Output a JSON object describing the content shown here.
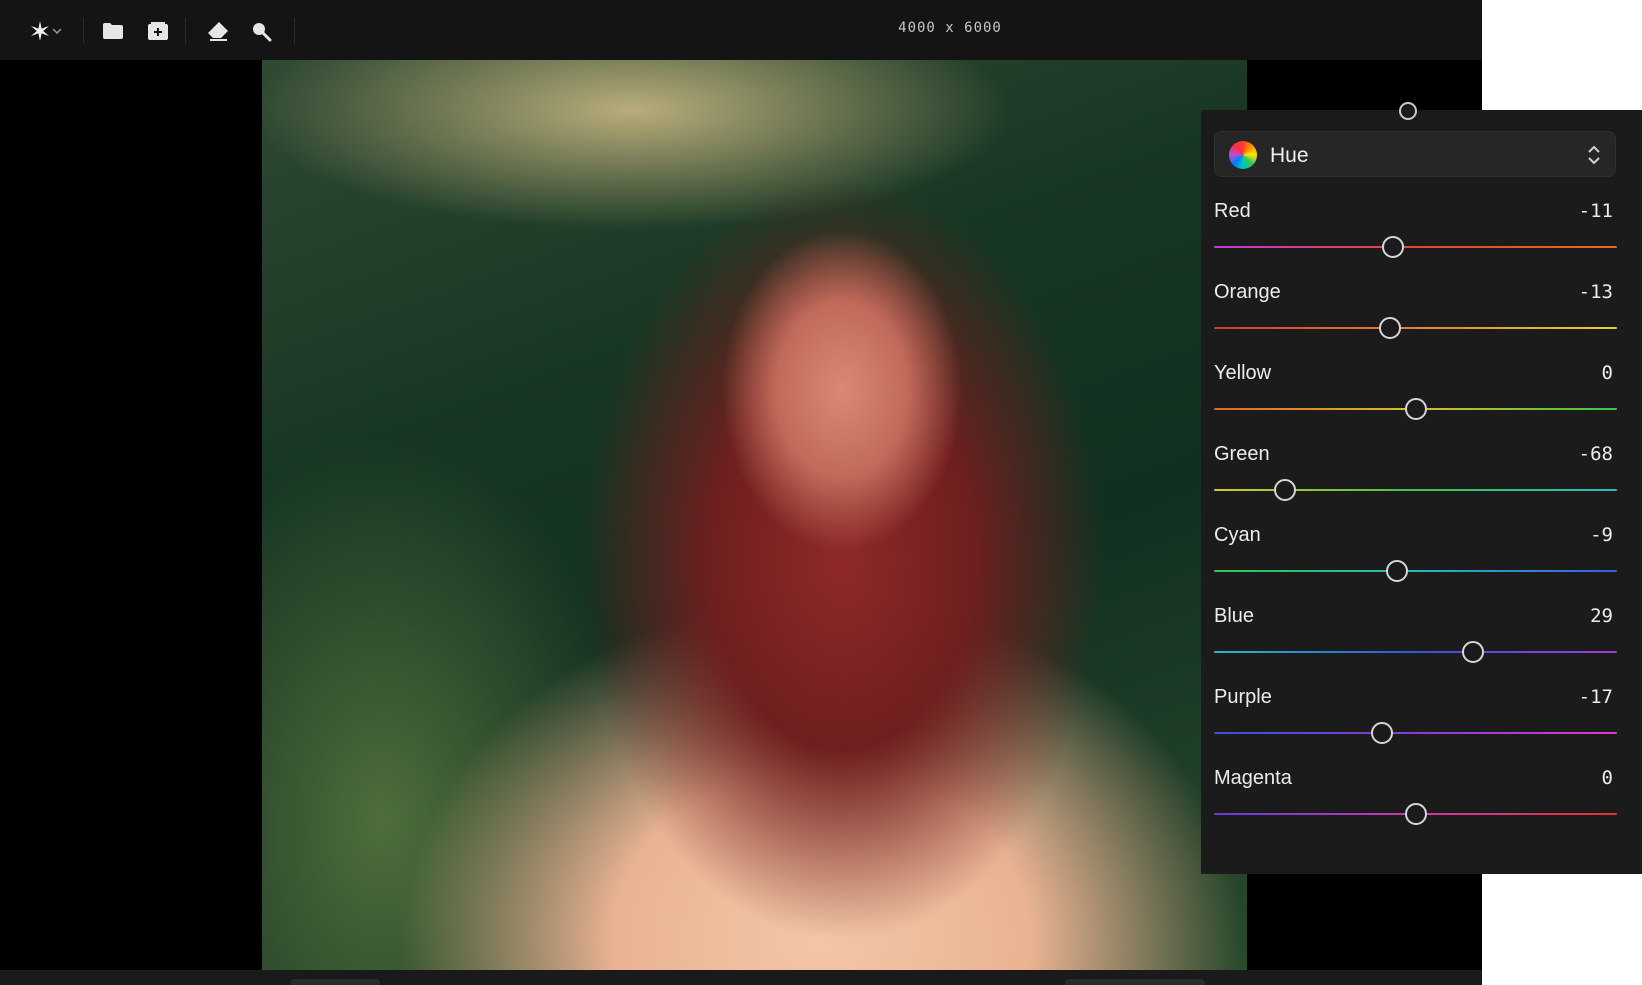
{
  "toolbar": {
    "dimensions": "4000 x 6000",
    "tools": [
      {
        "name": "sparkle-icon"
      },
      {
        "name": "chevron-down-icon"
      },
      {
        "name": "folder-icon"
      },
      {
        "name": "add-image-icon"
      },
      {
        "name": "eraser-icon"
      },
      {
        "name": "zoom-icon"
      }
    ]
  },
  "panel": {
    "mode_select": {
      "label": "Hue",
      "icon": "color-wheel-icon"
    },
    "sliders": [
      {
        "label": "Red",
        "value": "-11",
        "position": 0.445,
        "colors": [
          "#c23ad6",
          "#e0492f",
          "#e8672a"
        ]
      },
      {
        "label": "Orange",
        "value": "-13",
        "position": 0.437,
        "colors": [
          "#d43a35",
          "#e6842a",
          "#e6d22a"
        ]
      },
      {
        "label": "Yellow",
        "value": "0",
        "position": 0.5,
        "colors": [
          "#e0652a",
          "#d7c02a",
          "#3cc24a"
        ]
      },
      {
        "label": "Green",
        "value": "-68",
        "position": 0.175,
        "colors": [
          "#d8c82a",
          "#40c24a",
          "#22bfc0"
        ]
      },
      {
        "label": "Cyan",
        "value": "-9",
        "position": 0.455,
        "colors": [
          "#37c24a",
          "#2ab8b8",
          "#3a5ce0"
        ]
      },
      {
        "label": "Blue",
        "value": "29",
        "position": 0.643,
        "colors": [
          "#2ab8bd",
          "#3454e0",
          "#a43ad8"
        ]
      },
      {
        "label": "Purple",
        "value": "-17",
        "position": 0.418,
        "colors": [
          "#3a50e0",
          "#8a3ad8",
          "#e03ad0"
        ]
      },
      {
        "label": "Magenta",
        "value": "0",
        "position": 0.5,
        "colors": [
          "#6a3ad8",
          "#c83ab0",
          "#e0342f"
        ]
      }
    ]
  }
}
